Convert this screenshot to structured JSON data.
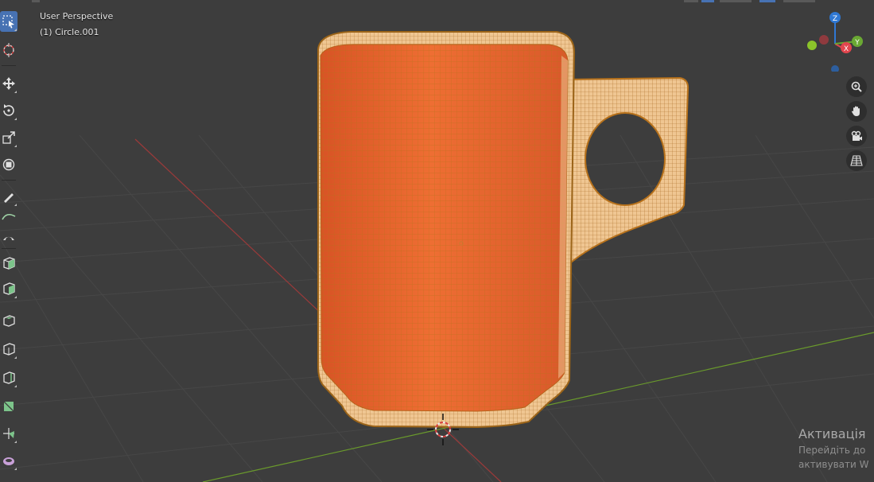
{
  "viewport": {
    "view_name": "User Perspective",
    "object_name": "(1) Circle.001"
  },
  "gizmo": {
    "z_label": "Z",
    "y_label": "Y",
    "x_label": "X",
    "colors": {
      "x": "#e2464e",
      "y": "#6aa833",
      "z": "#2f78d4",
      "neg_x": "#8f3a3e",
      "neg_y": "#5aa82a",
      "neg_z": "#2d5e9e"
    }
  },
  "toolbar": {
    "tools": [
      {
        "name": "select-box",
        "icon": "select-box-icon",
        "active": true
      },
      {
        "name": "cursor",
        "icon": "cursor-icon",
        "active": false
      },
      {
        "name": "move",
        "icon": "move-icon",
        "active": false
      },
      {
        "name": "rotate",
        "icon": "rotate-icon",
        "active": false
      },
      {
        "name": "scale",
        "icon": "scale-icon",
        "active": false
      },
      {
        "name": "transform",
        "icon": "transform-icon",
        "active": false
      },
      {
        "name": "annotate",
        "icon": "annotate-icon",
        "active": false
      },
      {
        "name": "measure",
        "icon": "measure-icon",
        "active": false
      },
      {
        "name": "extrude",
        "icon": "extrude-icon",
        "active": false
      },
      {
        "name": "inset",
        "icon": "inset-icon",
        "active": false
      },
      {
        "name": "bevel",
        "icon": "bevel-icon",
        "active": false
      },
      {
        "name": "loop-cut",
        "icon": "loop-cut-icon",
        "active": false
      },
      {
        "name": "knife",
        "icon": "knife-icon",
        "active": false
      },
      {
        "name": "poly-build",
        "icon": "poly-build-icon",
        "active": false
      },
      {
        "name": "spin",
        "icon": "spin-icon",
        "active": false
      },
      {
        "name": "smooth",
        "icon": "smooth-icon",
        "active": false
      }
    ]
  },
  "nav_buttons": [
    "zoom-icon",
    "hand-pan-icon",
    "camera-icon",
    "grid-perspective-icon"
  ],
  "activation": {
    "title": "Активація",
    "line1": "Перейдіть до",
    "line2": "активувати W"
  },
  "colors": {
    "background": "#3d3d3d",
    "mesh_face": "#e0622a",
    "mesh_edge": "#b8721b",
    "mesh_rim": "#efc692",
    "axis_x": "#9b3a3a",
    "axis_y": "#6a9a2c",
    "active_tool": "#4772b3"
  }
}
